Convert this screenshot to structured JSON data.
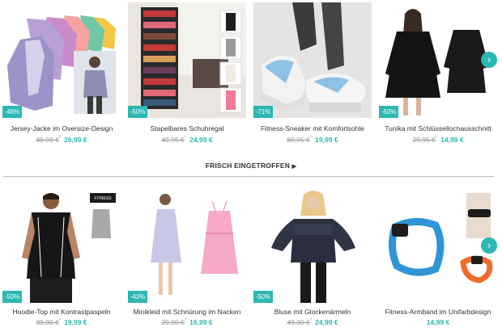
{
  "accent": "#2bb8b3",
  "section": {
    "title": "FRISCH EINGETROFFEN",
    "arrow": "▶"
  },
  "next_icon": "›",
  "row1": [
    {
      "title": "Jersey-Jacke im Oversize-Design",
      "badge": "-46%",
      "old": "49,99 €",
      "star": "*",
      "new": "26,99 €"
    },
    {
      "title": "Stapelbares Schuhregal",
      "badge": "-50%",
      "old": "49,95 €",
      "star": "*",
      "new": "24,99 €"
    },
    {
      "title": "Fitness-Sneaker mit Komfortsohle",
      "badge": "-71%",
      "old": "69,95 €",
      "star": "*",
      "new": "19,99 €"
    },
    {
      "title": "Tunika mit Schlüssellochausschnitt",
      "badge": "-50%",
      "old": "29,95 €",
      "star": "*",
      "new": "14,99 €"
    }
  ],
  "row2": [
    {
      "title": "Hoodie-Top mit Kontrastpaspeln",
      "badge": "-50%",
      "old": "39,90 €",
      "star": "*",
      "new": "19,99 €",
      "brand": "FITNESS"
    },
    {
      "title": "Minikleid mit Schnürung im Nacken",
      "badge": "-43%",
      "old": "29,90 €",
      "star": "*",
      "new": "16,99 €"
    },
    {
      "title": "Bluse mit Glockenärmeln",
      "badge": "-50%",
      "old": "49,90 €",
      "star": "*",
      "new": "24,99 €"
    },
    {
      "title": "Fitness-Armband im Unifarbdesign",
      "badge": "",
      "old": "",
      "star": "",
      "new": "14,99 €"
    }
  ]
}
